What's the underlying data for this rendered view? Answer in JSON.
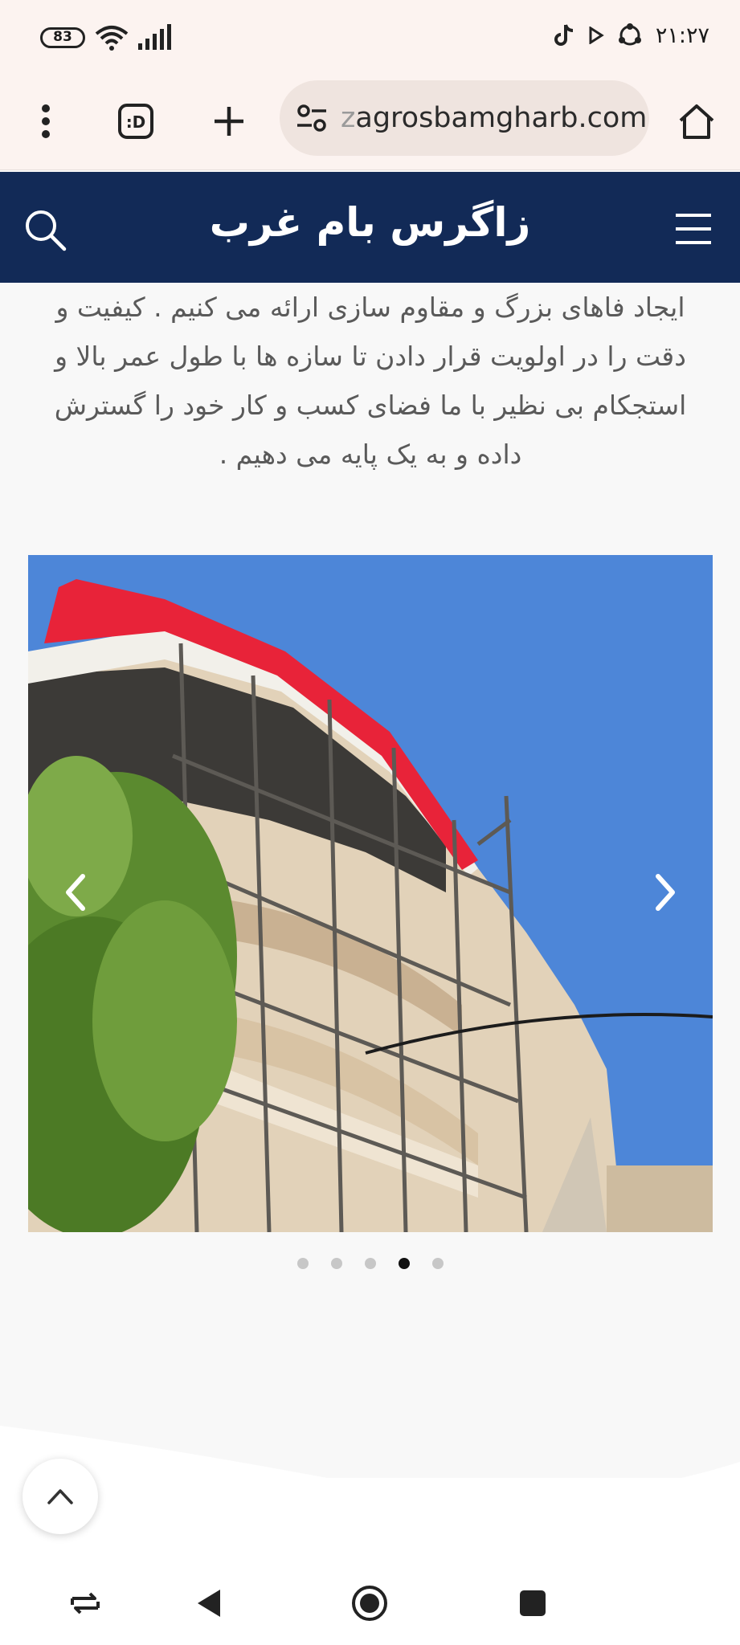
{
  "status_bar": {
    "battery": "83",
    "time": "۲۱:۲۷"
  },
  "browser": {
    "url_faded": "z",
    "url_main": "agrosbamgharb.com"
  },
  "site": {
    "title": "زاگرس بام غرب"
  },
  "intro": {
    "text": "ایجاد فاهای بزرگ و مقاوم سازی ارائه می کنیم . کیفیت و دقت را در اولویت قرار دادن تا سازه ها با طول عمر بالا و استجکام بی نظیر با ما فضای کسب و کار خود را گسترش داده و به یک پایه می دهیم ."
  },
  "carousel": {
    "slide_count": 5,
    "active_index": 3,
    "image_description_icon": "building-roof-photo"
  },
  "colors": {
    "header_bg": "#122a57",
    "chrome_bg": "#fcf3f0",
    "roof_red": "#e8243a",
    "sky": "#4f86d6"
  }
}
